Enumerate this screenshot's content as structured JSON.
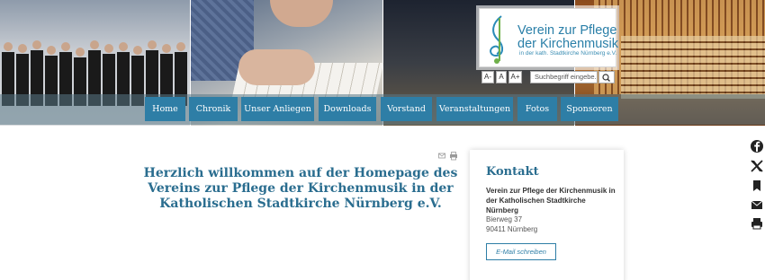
{
  "header": {
    "logo_line1": "Verein zur Pflege",
    "logo_line2": "der Kirchenmusik",
    "logo_line3": "in der kath. Stadtkirche Nürnberg e.V.",
    "font_smaller": "A-",
    "font_normal": "A",
    "font_larger": "A+",
    "search_placeholder": "Suchbegriff eingebe..."
  },
  "nav": {
    "items": [
      {
        "label": "Home"
      },
      {
        "label": "Chronik"
      },
      {
        "label": "Unser Anliegen"
      },
      {
        "label": "Downloads"
      },
      {
        "label": "Vorstand"
      },
      {
        "label": "Veranstaltungen"
      },
      {
        "label": "Fotos"
      },
      {
        "label": "Sponsoren"
      }
    ]
  },
  "main": {
    "welcome": "Herzlich willkommen auf der Homepage des Vereins zur Pflege der Kirchenmusik in der Katholischen Stadtkirche Nürnberg e.V."
  },
  "contact": {
    "title": "Kontakt",
    "name": "Verein zur Pflege der Kirchenmusik in der Katholischen Stadtkirche Nürnberg",
    "street": "Bierweg 37",
    "city": "90411 Nürnberg",
    "mail_button": "E-Mail schreiben"
  },
  "share": {
    "icons": [
      "facebook-icon",
      "x-icon",
      "bookmark-icon",
      "mail-icon",
      "print-icon"
    ]
  },
  "colors": {
    "accent": "#2e7ea6",
    "heading": "#2a6d8f"
  }
}
